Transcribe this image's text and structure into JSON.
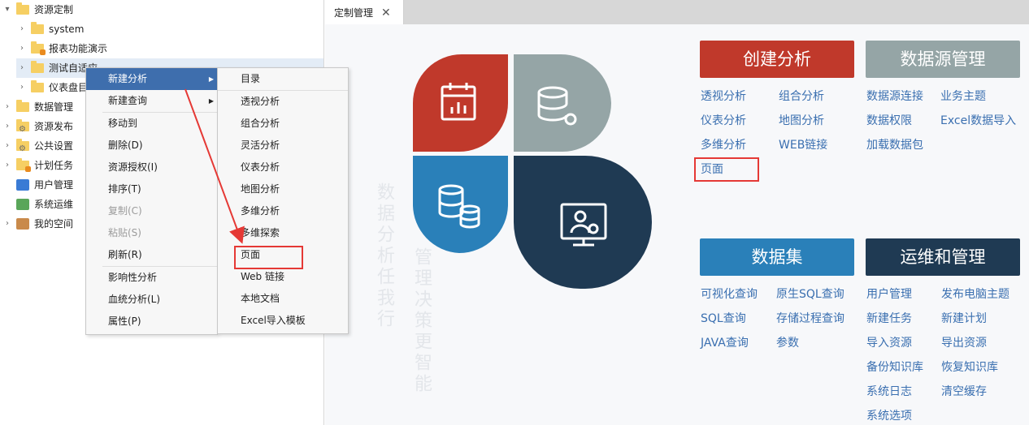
{
  "tree": {
    "items": [
      {
        "label": "资源定制",
        "icon": "folder-icon",
        "chevron": "▾"
      },
      {
        "label": "system",
        "icon": "folder-icon",
        "chevron": "›"
      },
      {
        "label": "报表功能演示",
        "icon": "folder-lock-icon",
        "chevron": "›"
      },
      {
        "label": "测试自适应",
        "icon": "folder-icon",
        "chevron": "›"
      },
      {
        "label": "仪表盘目录",
        "icon": "folder-icon",
        "chevron": "›"
      },
      {
        "label": "数据管理",
        "icon": "data-folder-icon",
        "chevron": "›"
      },
      {
        "label": "资源发布",
        "icon": "publish-icon",
        "chevron": "›"
      },
      {
        "label": "公共设置",
        "icon": "settings-icon",
        "chevron": "›"
      },
      {
        "label": "计划任务",
        "icon": "schedule-icon",
        "chevron": "›"
      },
      {
        "label": "用户管理",
        "icon": "user-icon",
        "chevron": ""
      },
      {
        "label": "系统运维",
        "icon": "ops-icon",
        "chevron": ""
      },
      {
        "label": "我的空间",
        "icon": "space-icon",
        "chevron": "›"
      }
    ]
  },
  "context_menu": {
    "items": [
      {
        "label": "新建分析",
        "submenu": true
      },
      {
        "label": "新建查询",
        "submenu": true
      },
      {
        "label": "移动到"
      },
      {
        "label": "删除(D)"
      },
      {
        "label": "资源授权(I)"
      },
      {
        "label": "排序(T)"
      },
      {
        "label": "复制(C)"
      },
      {
        "label": "粘贴(S)"
      },
      {
        "label": "刷新(R)"
      },
      {
        "label": "影响性分析"
      },
      {
        "label": "血统分析(L)"
      },
      {
        "label": "属性(P)"
      }
    ]
  },
  "submenu": {
    "items": [
      "目录",
      "透视分析",
      "组合分析",
      "灵活分析",
      "仪表分析",
      "地图分析",
      "多维分析",
      "多维探索",
      "页面",
      "Web 链接",
      "本地文档",
      "Excel导入模板"
    ]
  },
  "tab": {
    "label": "定制管理",
    "close": "✕"
  },
  "watermark": {
    "col1": "数据分析任我行",
    "col2": "管理决策更智能"
  },
  "cards": {
    "create": {
      "title": "创建分析",
      "color": "#c0392b",
      "links": [
        "透视分析",
        "组合分析",
        "仪表分析",
        "地图分析",
        "多维分析",
        "WEB链接",
        "页面"
      ]
    },
    "datasource": {
      "title": "数据源管理",
      "color": "#95a5a6",
      "links": [
        "数据源连接",
        "业务主题",
        "数据权限",
        "Excel数据导入",
        "加载数据包"
      ]
    },
    "dataset": {
      "title": "数据集",
      "color": "#2a80b9",
      "links": [
        "可视化查询",
        "原生SQL查询",
        "SQL查询",
        "存储过程查询",
        "JAVA查询",
        "参数"
      ]
    },
    "ops": {
      "title": "运维和管理",
      "color": "#1f3a53",
      "links": [
        "用户管理",
        "发布电脑主题",
        "新建任务",
        "新建计划",
        "导入资源",
        "导出资源",
        "备份知识库",
        "恢复知识库",
        "系统日志",
        "清空缓存",
        "系统选项"
      ]
    }
  },
  "colors": {
    "accent": "#e53935",
    "menu_active": "#3e6ead",
    "link": "#3a6fb0"
  }
}
